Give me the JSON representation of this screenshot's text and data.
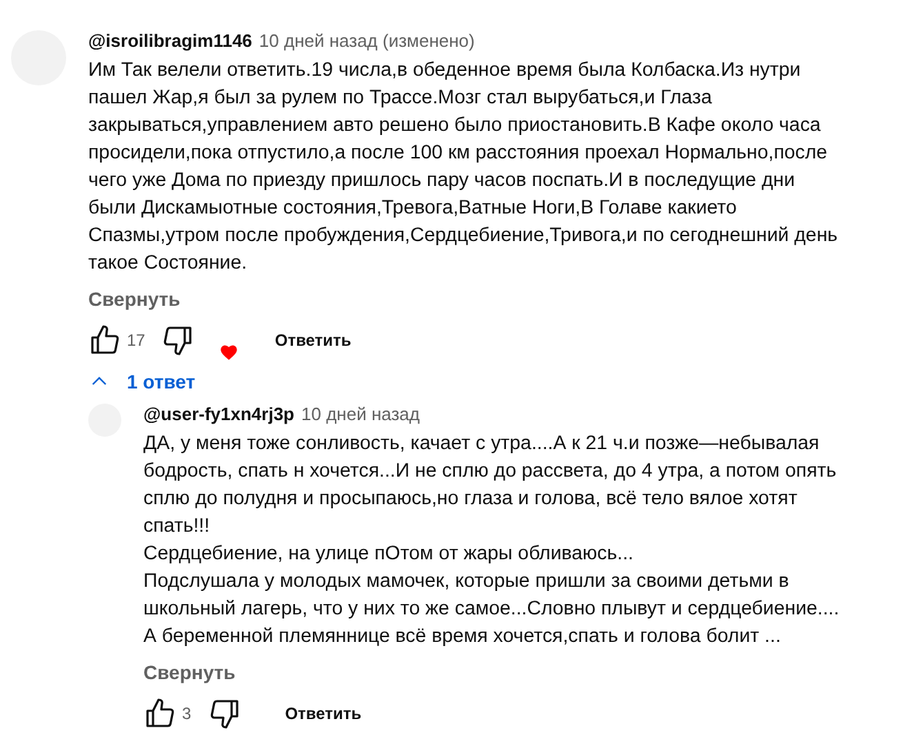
{
  "comments": [
    {
      "author": "@isroilibragim1146",
      "time": "10 дней назад (изменено)",
      "lines": [
        "Им Так велели ответить.19 числа,в обеденное время была Колбаска.Из нутри",
        "пашел Жар,я был за рулем по Трассе.Мозг стал вырубаться,и Глаза",
        "закрываться,управлением авто решено было приостановить.В Кафе около часа",
        "просидели,пока отпустило,а после 100 км расстояния проехал Нормально,после",
        "чего уже Дома по приезду пришлось пару часов поспать.И в последущие дни",
        "были Дискамыотные состояния,Тревога,Ватные Ноги,В Голаве какието",
        "Спазмы,утром после пробуждения,Сердцебиение,Тривога,и по сегоднешний день",
        "такое Состояние."
      ],
      "collapse": "Свернуть",
      "likes": "17",
      "hearted": true,
      "reply_label": "Ответить",
      "replies_toggle": {
        "label": "1 ответ",
        "expanded": true
      },
      "replies": [
        {
          "author": "@user-fy1xn4rj3p",
          "time": "10 дней назад",
          "lines": [
            "ДА, у меня тоже сонливость, качает с утра....А к 21 ч.и позже—небывалая",
            "бодрость, спать н хочется...И не сплю до рассвета, до 4 утра, а потом опять",
            "сплю до полудня и просыпаюсь,но глаза и голова, всё тело вялое хотят",
            "спать!!!",
            "Сердцебиение, на улице пОтом от жары обливаюсь...",
            "Подслушала у молодых мамочек, которые пришли за своими детьми в",
            "школьный лагерь, что у них то же самое...Словно плывут и сердцебиение....",
            "А беременной племяннице всё время хочется,спать и голова болит ..."
          ],
          "collapse": "Свернуть",
          "likes": "3",
          "reply_label": "Ответить"
        }
      ]
    }
  ]
}
